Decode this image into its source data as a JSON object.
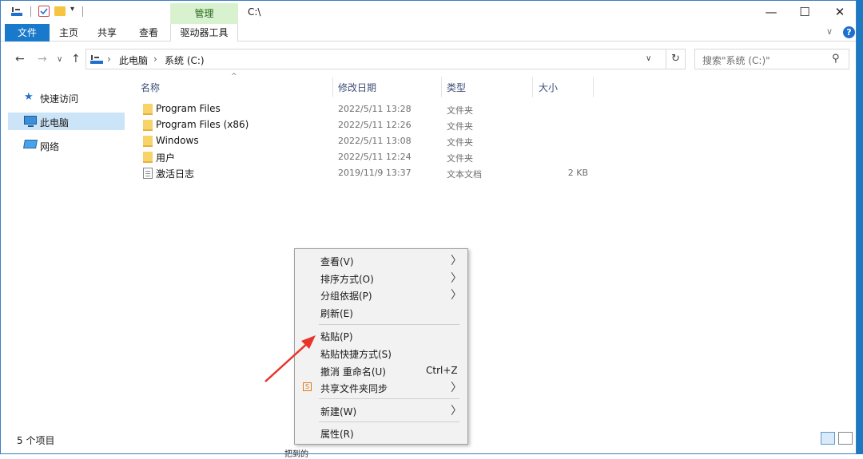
{
  "titlebar": {
    "title": "C:\\",
    "manage_tab": "管理",
    "dropdown_glyph": "▾",
    "minimize": "—",
    "maximize": "☐",
    "close": "✕"
  },
  "ribbon": {
    "tabs": [
      "文件",
      "主页",
      "共享",
      "查看",
      "驱动器工具"
    ],
    "expand_glyph": "∨",
    "help_glyph": "?"
  },
  "address": {
    "back": "←",
    "forward": "→",
    "recent": "∨",
    "up": "↑",
    "separator": "›",
    "crumbs": [
      "此电脑",
      "系统 (C:)"
    ],
    "dropdown": "∨",
    "refresh": "↻",
    "search_placeholder": "搜索\"系统 (C:)\"",
    "search_glyph": "⚲"
  },
  "sidebar": {
    "items": [
      {
        "label": "快速访问",
        "icon": "star-icon"
      },
      {
        "label": "此电脑",
        "icon": "computer-icon",
        "selected": true
      },
      {
        "label": "网络",
        "icon": "network-icon"
      }
    ]
  },
  "filelist": {
    "sort_glyph": "^",
    "columns": [
      "名称",
      "修改日期",
      "类型",
      "大小"
    ],
    "rows": [
      {
        "name": "Program Files",
        "date": "2022/5/11 13:28",
        "type": "文件夹",
        "size": ""
      },
      {
        "name": "Program Files (x86)",
        "date": "2022/5/11 12:26",
        "type": "文件夹",
        "size": ""
      },
      {
        "name": "Windows",
        "date": "2022/5/11 13:08",
        "type": "文件夹",
        "size": ""
      },
      {
        "name": "用户",
        "date": "2022/5/11 12:24",
        "type": "文件夹",
        "size": ""
      },
      {
        "name": "激活日志",
        "date": "2019/11/9 13:37",
        "type": "文本文档",
        "size": "2 KB"
      }
    ]
  },
  "context_menu": {
    "submenu_glyph": "〉",
    "items": [
      {
        "label": "查看(V)",
        "submenu": true
      },
      {
        "label": "排序方式(O)",
        "submenu": true
      },
      {
        "label": "分组依据(P)",
        "submenu": true
      },
      {
        "label": "刷新(E)"
      },
      {
        "label": "粘贴(P)"
      },
      {
        "label": "粘贴快捷方式(S)"
      },
      {
        "label": "撤消 重命名(U)",
        "shortcut": "Ctrl+Z"
      },
      {
        "label": "共享文件夹同步",
        "submenu": true,
        "icon": "sync-icon",
        "icon_glyph": "S"
      },
      {
        "label": "新建(W)",
        "submenu": true
      },
      {
        "label": "属性(R)"
      }
    ]
  },
  "statusbar": {
    "item_count": "5 个项目"
  },
  "taskbar_peek": "把到的",
  "colors": {
    "accent": "#1979ca",
    "manage_tab_bg": "#d8f2cf",
    "selected_bg": "#cce4f7",
    "annotation_arrow": "#e8342a"
  }
}
